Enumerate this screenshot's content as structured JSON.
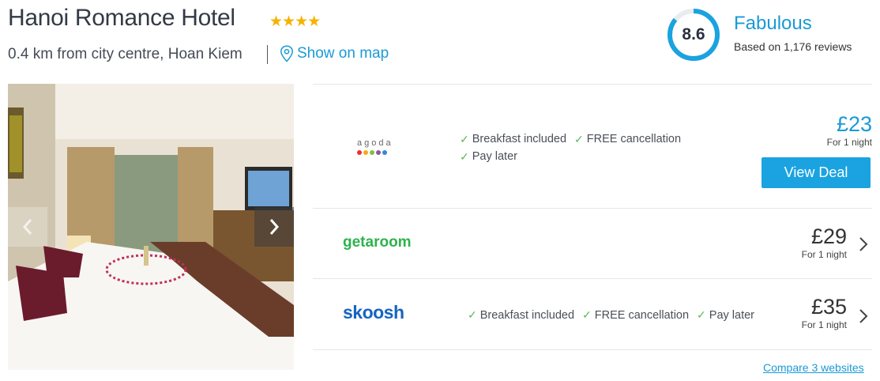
{
  "hotel": {
    "name": "Hanoi Romance Hotel",
    "stars": "★★★★",
    "location": "0.4 km from city centre, Hoan Kiem",
    "map_link": "Show on map"
  },
  "rating": {
    "score": "8.6",
    "label": "Fabulous",
    "reviews": "Based on 1,176 reviews",
    "accent": "#1aa3e0"
  },
  "deals": [
    {
      "partner": "agoda",
      "features": [
        "Breakfast included",
        "FREE cancellation",
        "Pay later"
      ],
      "price": "£23",
      "price_sub": "For 1 night",
      "button": "View Deal"
    },
    {
      "partner": "getaroom",
      "features": [],
      "price": "£29",
      "price_sub": "For 1 night"
    },
    {
      "partner": "skoosh",
      "features": [
        "Breakfast included",
        "FREE cancellation",
        "Pay later"
      ],
      "price": "£35",
      "price_sub": "For 1 night"
    }
  ],
  "compare": "Compare 3 websites",
  "colors": {
    "link": "#1a9ad6",
    "button": "#1aa3e0",
    "check": "#5cb85c",
    "star": "#f5b301",
    "getaroom": "#2fb24c",
    "skoosh": "#1565c0"
  }
}
